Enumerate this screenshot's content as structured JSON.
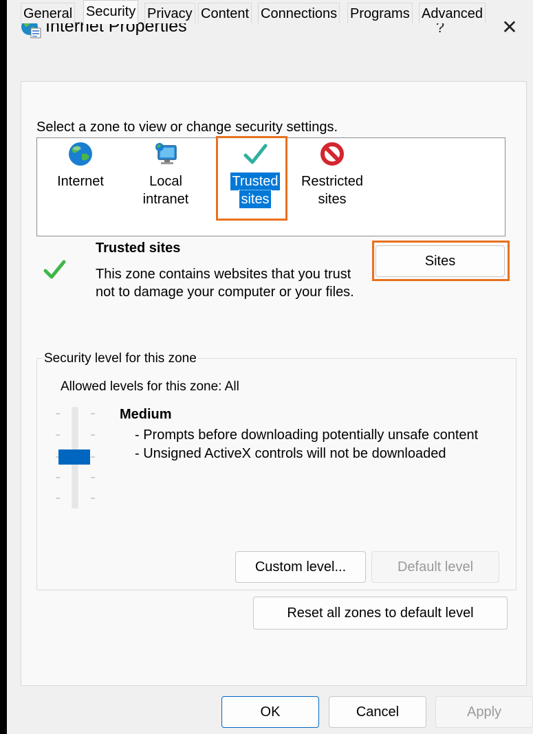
{
  "window": {
    "title": "Internet Properties",
    "help_glyph": "?",
    "close_glyph": "✕"
  },
  "tabs": [
    {
      "label": "General"
    },
    {
      "label": "Security",
      "active": true
    },
    {
      "label": "Privacy"
    },
    {
      "label": "Content"
    },
    {
      "label": "Connections"
    },
    {
      "label": "Programs"
    },
    {
      "label": "Advanced"
    }
  ],
  "zones": {
    "prompt": "Select a zone to view or change security settings.",
    "items": [
      {
        "line1": "Internet",
        "line2": "",
        "icon": "globe-icon"
      },
      {
        "line1": "Local",
        "line2": "intranet",
        "icon": "intranet-computer-icon"
      },
      {
        "line1": "Trusted",
        "line2": "sites",
        "icon": "checkmark-icon",
        "selected": true
      },
      {
        "line1": "Restricted",
        "line2": "sites",
        "icon": "restricted-icon"
      }
    ]
  },
  "zone_description": {
    "title": "Trusted sites",
    "text": "This zone contains websites that you trust not to damage your computer or your files.",
    "icon": "checkmark-icon"
  },
  "sites_button": "Sites",
  "security_level": {
    "legend": "Security level for this zone",
    "allowed": "Allowed levels for this zone: All",
    "level_name": "Medium",
    "descriptions": [
      "- Prompts before downloading potentially unsafe content",
      "- Unsigned ActiveX controls will not be downloaded"
    ],
    "slider_position": "3 of 5",
    "custom_level_button": "Custom level...",
    "default_level_button": "Default level"
  },
  "reset_button": "Reset all zones to default level",
  "footer": {
    "ok": "OK",
    "cancel": "Cancel",
    "apply": "Apply"
  },
  "colors": {
    "accent": "#0078d7",
    "highlight": "#e8711d",
    "check_green": "#3fb64a",
    "restricted_red": "#d3262e"
  }
}
